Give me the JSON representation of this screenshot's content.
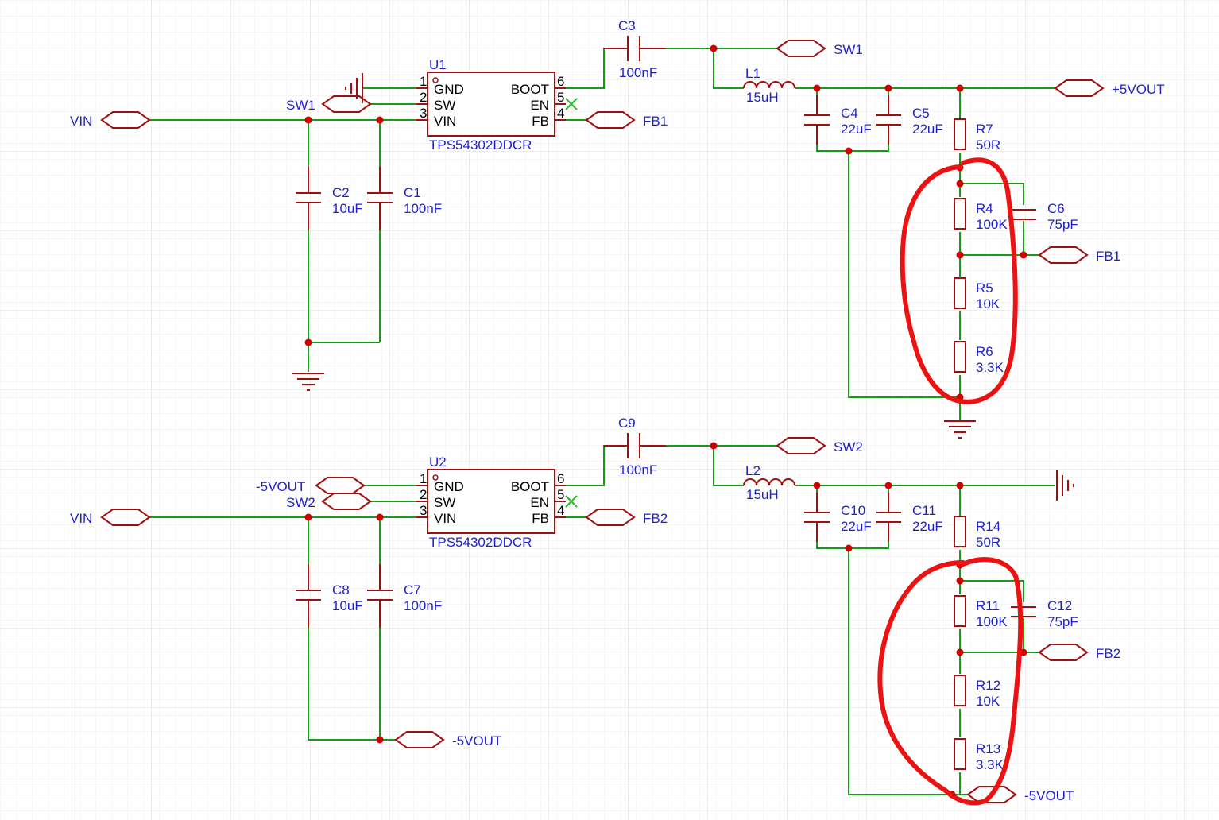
{
  "colors": {
    "wire": "#1a9a1a",
    "part": "#a01010",
    "text": "#1f1fd0",
    "junction": "#d00000",
    "annotation": "#ee1111",
    "grid": "#e6e6e6"
  },
  "top": {
    "ic_ref": "U1",
    "ic_part": "TPS54302DDCR",
    "pins": {
      "p1": "1",
      "p2": "2",
      "p3": "3",
      "p4": "4",
      "p5": "5",
      "p6": "6",
      "gnd": "GND",
      "sw": "SW",
      "vin": "VIN",
      "boot": "BOOT",
      "en": "EN",
      "fb": "FB"
    },
    "vin": "VIN",
    "sw_label": "SW1",
    "sw_port": "SW1",
    "fb_port": "FB1",
    "fb_port2": "FB1",
    "out": "+5VOUT",
    "c3": {
      "ref": "C3",
      "val": "100nF"
    },
    "l": {
      "ref": "L1",
      "val": "15uH"
    },
    "c_in_a": {
      "ref": "C2",
      "val": "10uF"
    },
    "c_in_b": {
      "ref": "C1",
      "val": "100nF"
    },
    "c_out_a": {
      "ref": "C4",
      "val": "22uF"
    },
    "c_out_b": {
      "ref": "C5",
      "val": "22uF"
    },
    "r_top": {
      "ref": "R7",
      "val": "50R"
    },
    "r_a": {
      "ref": "R4",
      "val": "100K"
    },
    "c_ff": {
      "ref": "C6",
      "val": "75pF"
    },
    "r_b": {
      "ref": "R5",
      "val": "10K"
    },
    "r_c": {
      "ref": "R6",
      "val": "3.3K"
    }
  },
  "bottom": {
    "ic_ref": "U2",
    "ic_part": "TPS54302DDCR",
    "pins": {
      "p1": "1",
      "p2": "2",
      "p3": "3",
      "p4": "4",
      "p5": "5",
      "p6": "6",
      "gnd": "GND",
      "sw": "SW",
      "vin": "VIN",
      "boot": "BOOT",
      "en": "EN",
      "fb": "FB"
    },
    "vin": "VIN",
    "gnd_label": "-5VOUT",
    "sw_label": "SW2",
    "sw_port": "SW2",
    "fb_port": "FB2",
    "fb_port2": "FB2",
    "neg_out": "-5VOUT",
    "neg_out2": "-5VOUT",
    "c9": {
      "ref": "C9",
      "val": "100nF"
    },
    "l": {
      "ref": "L2",
      "val": "15uH"
    },
    "c_in_a": {
      "ref": "C8",
      "val": "10uF"
    },
    "c_in_b": {
      "ref": "C7",
      "val": "100nF"
    },
    "c_out_a": {
      "ref": "C10",
      "val": "22uF"
    },
    "c_out_b": {
      "ref": "C11",
      "val": "22uF"
    },
    "r_top": {
      "ref": "R14",
      "val": "50R"
    },
    "r_a": {
      "ref": "R11",
      "val": "100K"
    },
    "c_ff": {
      "ref": "C12",
      "val": "75pF"
    },
    "r_b": {
      "ref": "R12",
      "val": "10K"
    },
    "r_c": {
      "ref": "R13",
      "val": "3.3K"
    }
  }
}
